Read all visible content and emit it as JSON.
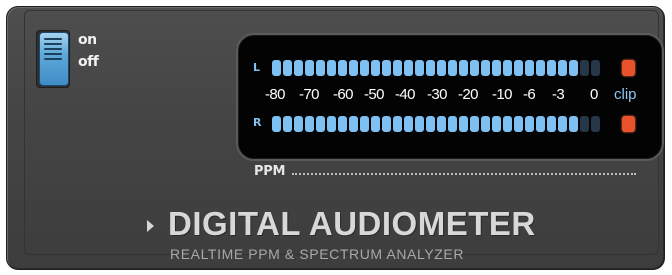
{
  "power_switch": {
    "on_label": "on",
    "off_label": "off",
    "state": "on"
  },
  "meter": {
    "left_label": "L",
    "right_label": "R",
    "scale_ticks": [
      "-80",
      "-70",
      "-60",
      "-50",
      "-40",
      "-30",
      "-20",
      "-10",
      "-6",
      "-3",
      "0"
    ],
    "clip_label": "clip",
    "left_segments_total": 30,
    "left_segments_lit": 28,
    "right_segments_total": 30,
    "right_segments_lit": 28,
    "clip_left_active": true,
    "clip_right_active": true,
    "lit_color": "#7ec0f2",
    "clip_color": "#e8522a"
  },
  "ppm_label": "PPM",
  "title": "DIGITAL AUDIOMETER",
  "subtitle": "REALTIME PPM & SPECTRUM ANALYZER"
}
